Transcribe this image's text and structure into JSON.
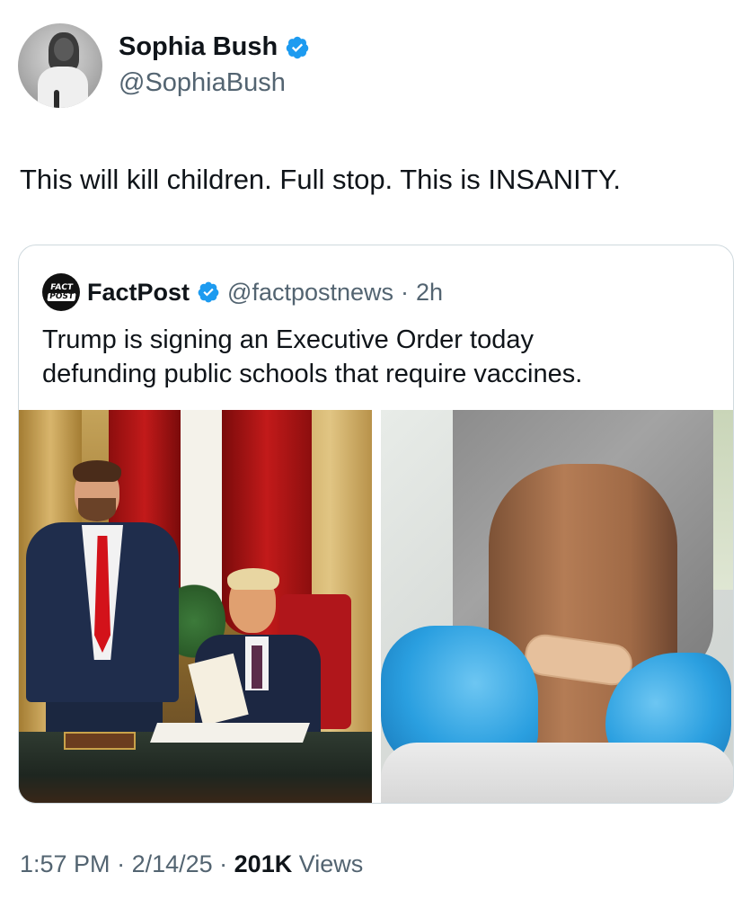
{
  "author": {
    "display_name": "Sophia Bush",
    "handle": "@SophiaBush",
    "verified_icon": "verified-badge-icon"
  },
  "tweet": {
    "text": "This will kill children. Full stop. This is INSANITY."
  },
  "quoted": {
    "logo_line1": "FACT",
    "logo_line2": "POST",
    "display_name": "FactPost",
    "handle": "@factpostnews",
    "separator": "·",
    "time": "2h",
    "text_line1": "Trump is signing an Executive Order today",
    "text_line2": "defunding public schools that require vaccines."
  },
  "footer": {
    "time": "1:57 PM",
    "sep1": " · ",
    "date": "2/14/25",
    "sep2": " · ",
    "views_count": "201K",
    "views_label": " Views"
  },
  "colors": {
    "verified_blue": "#1d9bf0",
    "secondary_text": "#536471",
    "primary_text": "#0f1419",
    "border": "#cfd9de"
  }
}
